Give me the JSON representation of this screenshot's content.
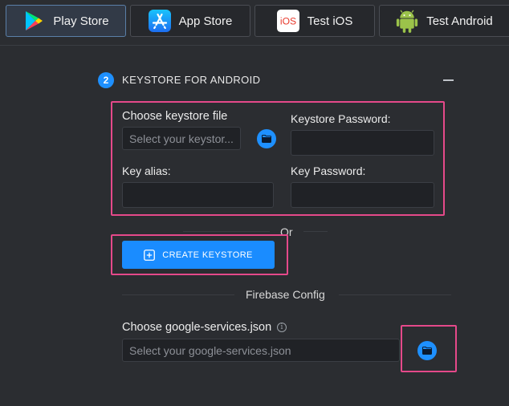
{
  "tabs": [
    {
      "label": "Play Store",
      "icon": "google-play-icon",
      "active": true
    },
    {
      "label": "App Store",
      "icon": "app-store-icon",
      "active": false
    },
    {
      "label": "Test iOS",
      "icon": "ios-icon",
      "active": false
    },
    {
      "label": "Test Android",
      "icon": "android-icon",
      "active": false
    }
  ],
  "ios_icon_text": "iOS",
  "section": {
    "step": "2",
    "title": "KEYSTORE FOR ANDROID"
  },
  "keystore": {
    "file_label": "Choose keystore file",
    "file_placeholder": "Select your keystor...",
    "password_label": "Keystore Password:",
    "alias_label": "Key alias:",
    "key_password_label": "Key Password:"
  },
  "or_text": "Or",
  "create_keystore_label": "CREATE KEYSTORE",
  "firebase": {
    "title": "Firebase Config",
    "file_label": "Choose google-services.json",
    "file_placeholder": "Select your google-services.json"
  },
  "colors": {
    "accent": "#1e90ff",
    "highlight": "#e5498a",
    "background": "#2b2d31"
  }
}
